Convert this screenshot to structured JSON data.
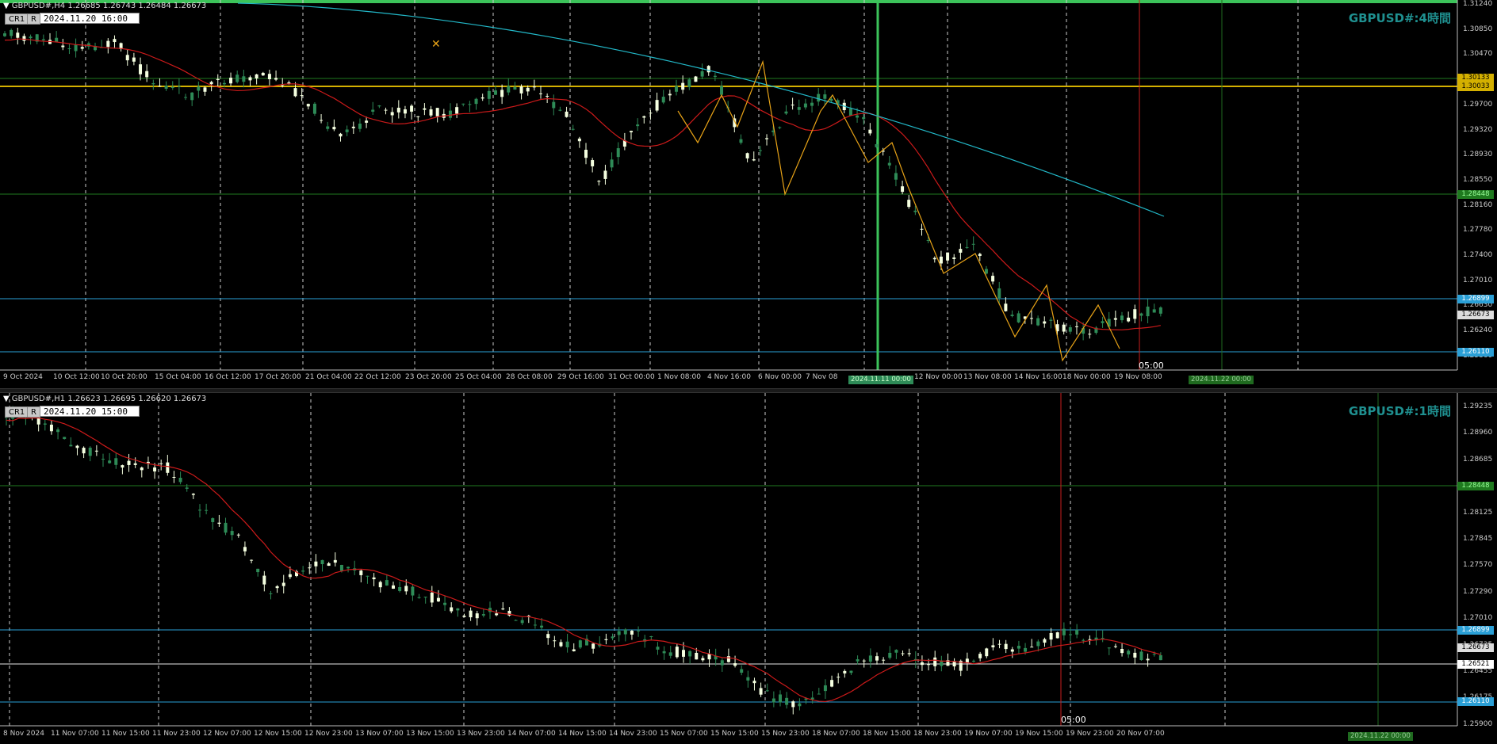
{
  "top_chart": {
    "header": "GBPUSD#,H4  1.26685 1.26743 1.26484 1.26673",
    "cr_label": "CR1",
    "r_label": "R",
    "time_box": "2024.11.20 16:00",
    "title": "GBPUSD#:4時間",
    "price_labels": [
      "1.31240",
      "1.30850",
      "1.30470",
      "1.30090",
      "1.29700",
      "1.29320",
      "1.28930",
      "1.28550",
      "1.28160",
      "1.27780",
      "1.27400",
      "1.27010",
      "1.26630",
      "1.26240",
      "1.25860"
    ],
    "date_labels": [
      "9 Oct 2024",
      "10 Oct 12:00",
      "10 Oct 20:00",
      "15 Oct 04:00",
      "16 Oct 12:00",
      "17 Oct 20:00",
      "21 Oct 04:00",
      "22 Oct 12:00",
      "23 Oct 20:00",
      "25 Oct 04:00",
      "28 Oct 08:00",
      "29 Oct 16:00",
      "31 Oct 00:00",
      "1 Nov 08:00",
      "4 Nov 16:00",
      "6 Nov 00:00",
      "7 Nov 08",
      "12 Nov 00:00",
      "13 Nov 08:00",
      "14 Nov 16:00",
      "18 Nov 00:00",
      "19 Nov 08:00"
    ],
    "tags": {
      "yellow1": "1.30133",
      "yellow2": "1.30033",
      "green": "1.28448",
      "blue_upper": "1.26899",
      "current": "1.26673",
      "blue_lower": "1.26110",
      "marked_date": "2024.11.11 00:00",
      "future_date": "2024.11.22 00:00",
      "time_marker": "05:00"
    },
    "colors": {
      "bull": "#f5ffe0",
      "bear": "#2e8b57",
      "ma_fast": "#cc1a1a",
      "ma_slow": "#22b8c8",
      "zigzag": "#e8a317",
      "hline_blue": "#2a9fd6",
      "hline_yellow": "#d4b000",
      "hline_green": "#1f7a1f"
    }
  },
  "bottom_chart": {
    "header": "GBPUSD#,H1  1.26623 1.26695 1.26620 1.26673",
    "cr_label": "CR1",
    "r_label": "R",
    "time_box": "2024.11.20 15:00",
    "title": "GBPUSD#:1時間",
    "price_labels": [
      "1.29235",
      "1.28960",
      "1.28685",
      "1.28405",
      "1.28125",
      "1.27845",
      "1.27570",
      "1.27290",
      "1.27010",
      "1.26735",
      "1.26455",
      "1.26175",
      "1.25900"
    ],
    "date_labels": [
      "8 Nov 2024",
      "11 Nov 07:00",
      "11 Nov 15:00",
      "11 Nov 23:00",
      "12 Nov 07:00",
      "12 Nov 15:00",
      "12 Nov 23:00",
      "13 Nov 07:00",
      "13 Nov 15:00",
      "13 Nov 23:00",
      "14 Nov 07:00",
      "14 Nov 15:00",
      "14 Nov 23:00",
      "15 Nov 07:00",
      "15 Nov 15:00",
      "15 Nov 23:00",
      "18 Nov 07:00",
      "18 Nov 15:00",
      "18 Nov 23:00",
      "19 Nov 07:00",
      "19 Nov 15:00",
      "19 Nov 23:00",
      "20 Nov 07:00"
    ],
    "tags": {
      "green": "1.28448",
      "blue_upper": "1.26899",
      "current": "1.26673",
      "white_line": "1.26521",
      "blue_lower": "1.26110",
      "future_date": "2024.11.22 00:00",
      "time_marker": "05:00"
    }
  }
}
